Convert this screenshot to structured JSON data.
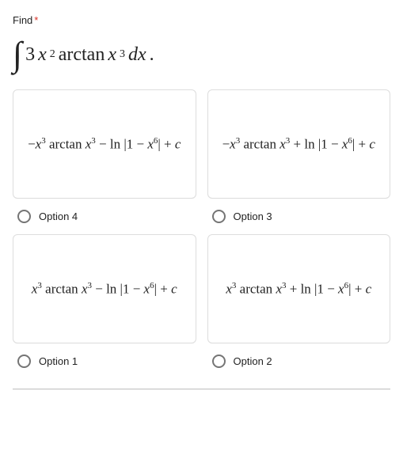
{
  "question": {
    "prompt": "Find",
    "required_marker": "*",
    "integral_html": "<span class='intsym'>∫</span> 3<i>x</i><sup>2</sup> arctan <i>x</i><sup>3</sup> <i>dx</i>."
  },
  "options": [
    {
      "formula_html": "−<i>x</i><sup>3</sup> arctan <i>x</i><sup>3</sup> − ln&nbsp;|1 − <i>x</i><sup>6</sup>| + <i>c</i>",
      "label": "Option 4"
    },
    {
      "formula_html": "−<i>x</i><sup>3</sup> arctan <i>x</i><sup>3</sup> + ln&nbsp;|1 − <i>x</i><sup>6</sup>| + <i>c</i>",
      "label": "Option 3"
    },
    {
      "formula_html": "<i>x</i><sup>3</sup> arctan <i>x</i><sup>3</sup> − ln&nbsp;|1 − <i>x</i><sup>6</sup>| + <i>c</i>",
      "label": "Option 1"
    },
    {
      "formula_html": "<i>x</i><sup>3</sup> arctan <i>x</i><sup>3</sup> + ln&nbsp;|1 − <i>x</i><sup>6</sup>| + <i>c</i>",
      "label": "Option 2"
    }
  ]
}
